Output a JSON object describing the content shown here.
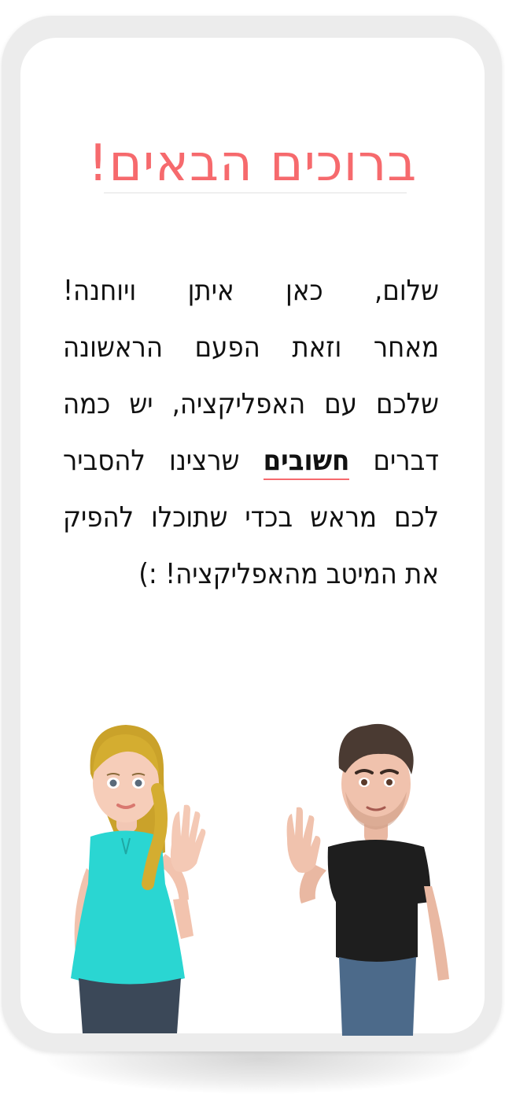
{
  "welcome": {
    "title": "ברוכים הבאים!",
    "intro_lines": [
      "שלום, כאן איתן ויוחנה!",
      "מאחר וזאת הפעם הראשונה",
      "שלכם עם האפליקציה, יש כמה"
    ],
    "line4_before": "דברים",
    "line4_emphasis": "חשובים",
    "line4_after": "שרצינו להסביר",
    "outro_lines": [
      "לכם מראש בכדי שתוכלו להפיק",
      "את המיטב מהאפליקציה! :)"
    ]
  },
  "colors": {
    "accent": "#f66a6d",
    "text": "#111111",
    "frame": "#ececec"
  },
  "icons": {
    "girl_avatar": "waving-girl-avatar",
    "boy_avatar": "waving-boy-avatar"
  }
}
